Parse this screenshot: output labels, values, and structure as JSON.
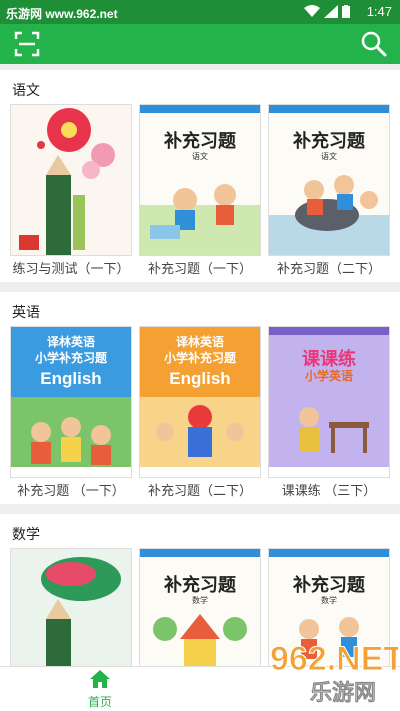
{
  "status_bar": {
    "site": "乐游网 www.962.net",
    "time": "1:47"
  },
  "appbar": {
    "scan_icon": "scan-icon",
    "search_icon": "search-icon"
  },
  "sections": [
    {
      "title": "语文",
      "books": [
        {
          "label": "练习与测试（一下）",
          "cover": "yuwen-1"
        },
        {
          "label": "补充习题（一下）",
          "cover": "yuwen-2"
        },
        {
          "label": "补充习题（二下）",
          "cover": "yuwen-3"
        }
      ]
    },
    {
      "title": "英语",
      "books": [
        {
          "label": "补充习题 （一下）",
          "cover": "english-1"
        },
        {
          "label": "补充习题（二下）",
          "cover": "english-2"
        },
        {
          "label": "课课练 （三下）",
          "cover": "english-3"
        }
      ]
    },
    {
      "title": "数学",
      "books": [
        {
          "label": "",
          "cover": "math-1"
        },
        {
          "label": "",
          "cover": "math-2"
        },
        {
          "label": "",
          "cover": "math-3"
        }
      ]
    }
  ],
  "covers": {
    "buchong": "补充习题",
    "yuwen_sub": "语文",
    "math_sub": "数学",
    "yilin_line1": "译林英语",
    "yilin_line2": "小学补充习题",
    "english": "English",
    "keke": "课课练",
    "keke_sub": "小学英语"
  },
  "bottom_nav": {
    "home_label": "首页"
  },
  "watermark": {
    "brand": "962.NET",
    "sub": "乐游网"
  },
  "colors": {
    "primary": "#23b34a",
    "status": "#1e8f36"
  }
}
